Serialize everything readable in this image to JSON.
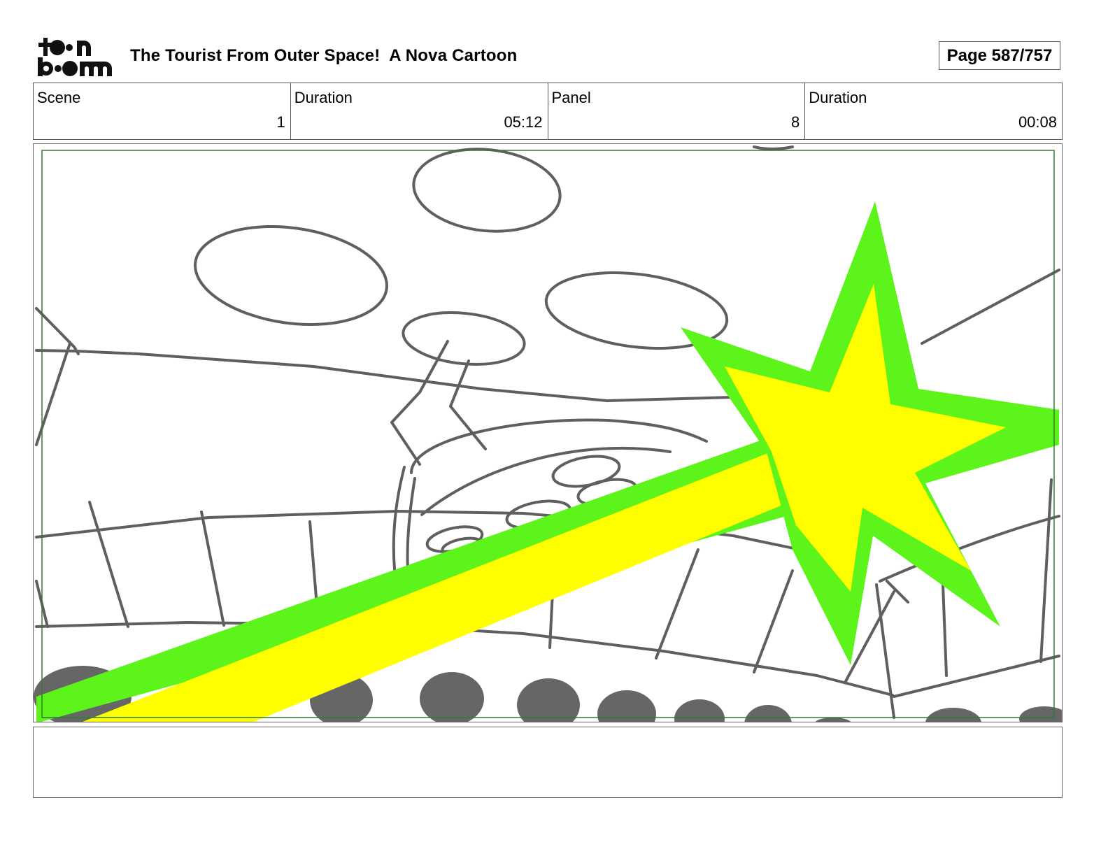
{
  "header": {
    "logo_text": "toon boom",
    "title": "The Tourist From Outer Space!  A Nova Cartoon",
    "page": "Page 587/757"
  },
  "info": {
    "scene_label": "Scene",
    "scene_value": "1",
    "scene_duration_label": "Duration",
    "scene_duration_value": "05:12",
    "panel_label": "Panel",
    "panel_value": "8",
    "panel_duration_label": "Duration",
    "panel_duration_value": "00:08"
  },
  "notes": {
    "text": ""
  },
  "colors": {
    "sketch": "#5f5f5f",
    "beam_outer": "#5cf41a",
    "beam_inner": "#ffff00",
    "safe_frame": "#2e7d2e",
    "border": "#555555"
  }
}
